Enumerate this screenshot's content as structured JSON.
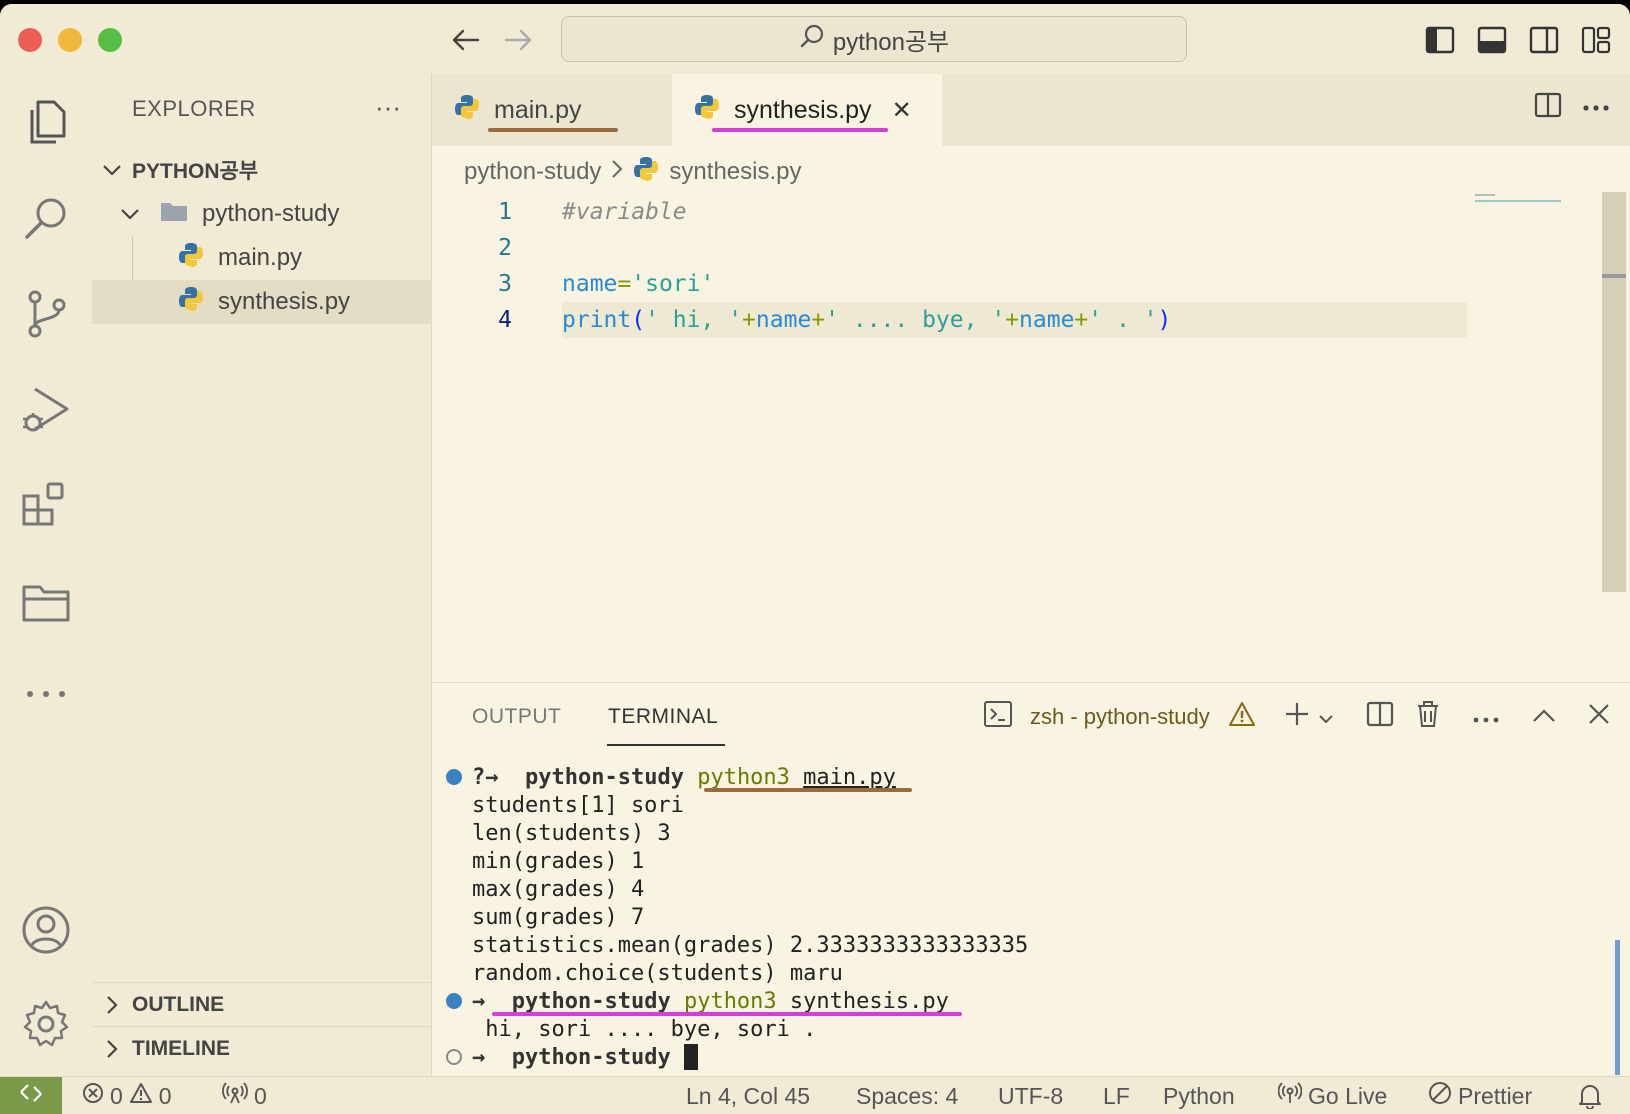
{
  "titlebar": {
    "search_text": "python공부"
  },
  "activity": [
    "explorer-icon",
    "search-icon",
    "source-control-icon",
    "run-debug-icon",
    "extensions-icon",
    "remote-explorer-icon",
    "more-icon",
    "account-icon",
    "settings-gear-icon"
  ],
  "sidebar": {
    "header": "EXPLORER",
    "more": "···",
    "root": "PYTHON공부",
    "folder": "python-study",
    "files": [
      "main.py",
      "synthesis.py"
    ],
    "outline": "OUTLINE",
    "timeline": "TIMELINE"
  },
  "tabs": [
    {
      "label": "main.py"
    },
    {
      "label": "synthesis.py",
      "close": "✕"
    }
  ],
  "breadcrumb": {
    "folder": "python-study",
    "file": "synthesis.py"
  },
  "editor": {
    "lines": [
      {
        "num": "1",
        "text": "#variable"
      },
      {
        "num": "2",
        "text": ""
      },
      {
        "num": "3",
        "var": "name",
        "eq": "=",
        "str": "'sori'"
      },
      {
        "num": "4",
        "fn": "print",
        "p1": "(",
        "s1": "' hi, '",
        "plus1": "+",
        "n1": "name",
        "plus2": "+",
        "s2": "' .... bye, '",
        "plus3": "+",
        "n2": "name",
        "plus4": "+",
        "s3": "' . '",
        "p2": ")"
      }
    ]
  },
  "panel": {
    "tabs": [
      "OUTPUT",
      "TERMINAL"
    ],
    "terminal_name": "zsh - python-study",
    "more": "···",
    "lines": [
      {
        "prefix": "?→",
        "dir": "python-study",
        "cmd": "python3",
        "arg": "main.py"
      },
      {
        "text": "students[1] sori"
      },
      {
        "text": "len(students) 3"
      },
      {
        "text": "min(grades) 1"
      },
      {
        "text": "max(grades) 4"
      },
      {
        "text": "sum(grades) 7"
      },
      {
        "text": "statistics.mean(grades) 2.3333333333333335"
      },
      {
        "text": "random.choice(students) maru"
      },
      {
        "prefix": "→",
        "dir": "python-study",
        "cmd": "python3",
        "arg": "synthesis.py"
      },
      {
        "text": " hi, sori .... bye, sori ."
      },
      {
        "prefix": "→",
        "dir": "python-study"
      }
    ]
  },
  "statusbar": {
    "errors": "0",
    "warnings": "0",
    "ports": "0",
    "position": "Ln 4, Col 45",
    "spaces": "Spaces: 4",
    "encoding": "UTF-8",
    "eol": "LF",
    "language": "Python",
    "golive": "Go Live",
    "prettier": "Prettier"
  },
  "colors": {
    "background": "#f9f4e2",
    "chrome": "#f1ebd6",
    "brown_underline": "#9a6b3c",
    "magenta_underline": "#d63ddb",
    "remote": "#7a9a4a"
  }
}
